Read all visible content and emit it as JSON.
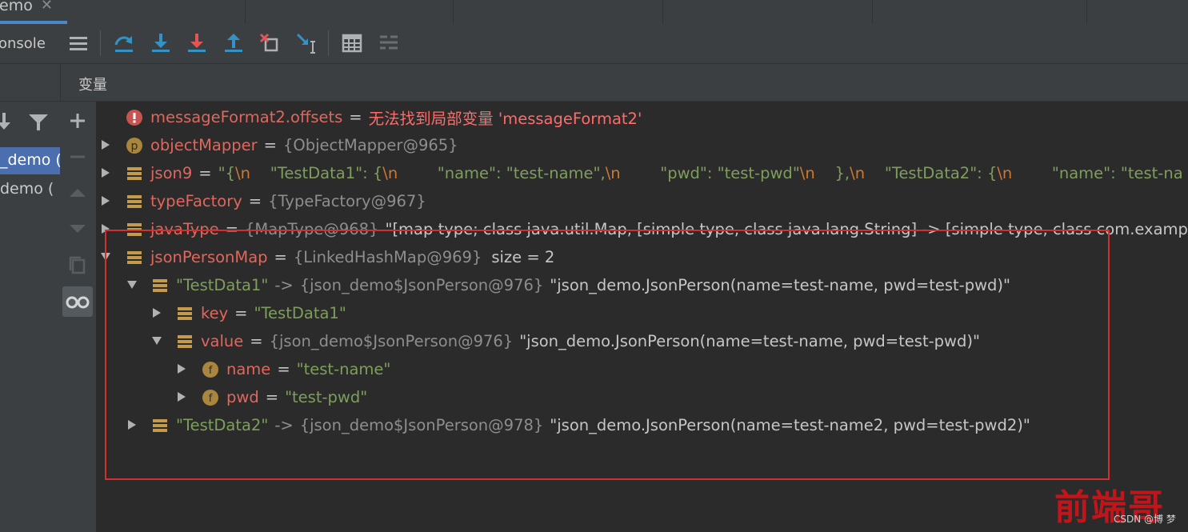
{
  "tab": {
    "title": "emo",
    "close": "✕"
  },
  "toolbar": {
    "console_label": "onsole",
    "icons": [
      "list-icon",
      "step-over-icon",
      "step-into-icon",
      "force-step-into-icon",
      "step-out-icon",
      "drop-frame-icon",
      "run-to-cursor-icon",
      "evaluate-icon",
      "trace-icon"
    ]
  },
  "header": {
    "title": "变量"
  },
  "frames": {
    "items": [
      "_demo (",
      "demo ("
    ]
  },
  "variables": [
    {
      "name": "messageFormat2.offsets",
      "eq": "=",
      "value": "无法找到局部变量 'messageFormat2'"
    },
    {
      "name": "objectMapper",
      "eq": "=",
      "ref": "{ObjectMapper@965}"
    },
    {
      "name": "json9",
      "eq": "=",
      "q1": "\"",
      "p1": "{",
      "esc1": "\\n",
      "p2": "    \"TestData1\": {",
      "esc2": "\\n",
      "p3": "        \"name\": \"test-name\",",
      "esc3": "\\n",
      "p4": "        \"pwd\": \"test-pwd\"",
      "esc4": "\\n",
      "p5": "    },",
      "esc5": "\\n",
      "p6": "    \"TestData2\": {",
      "esc6": "\\n",
      "p7": "        \"name\": \"test-na"
    },
    {
      "name": "typeFactory",
      "eq": "=",
      "ref": "{TypeFactory@967}"
    },
    {
      "name": "javaType",
      "eq": "=",
      "ref": "{MapType@968}",
      "value": "\"[map type; class java.util.Map, [simple type, class java.lang.String] -> [simple type, class com.examp"
    },
    {
      "name": "jsonPersonMap",
      "eq": "=",
      "ref": "{LinkedHashMap@969}",
      "size": "size = 2"
    },
    {
      "key": "\"TestData1\"",
      "arrow": "->",
      "ref": "{json_demo$JsonPerson@976}",
      "value": "\"json_demo.JsonPerson(name=test-name, pwd=test-pwd)\""
    },
    {
      "name": "key",
      "eq": "=",
      "value": "\"TestData1\""
    },
    {
      "name": "value",
      "eq": "=",
      "ref": "{json_demo$JsonPerson@976}",
      "value": "\"json_demo.JsonPerson(name=test-name, pwd=test-pwd)\""
    },
    {
      "name": "name",
      "eq": "=",
      "value": "\"test-name\""
    },
    {
      "name": "pwd",
      "eq": "=",
      "value": "\"test-pwd\""
    },
    {
      "key": "\"TestData2\"",
      "arrow": "->",
      "ref": "{json_demo$JsonPerson@978}",
      "value": "\"json_demo.JsonPerson(name=test-name2, pwd=test-pwd2)\""
    }
  ],
  "watermark": {
    "title": "前端哥",
    "sub": "CSDN @博 梦"
  },
  "colors": {
    "accent": "#4a88c7",
    "error": "#ff6b68",
    "string": "#7e9e5c",
    "highlight": "#d32f2f"
  }
}
